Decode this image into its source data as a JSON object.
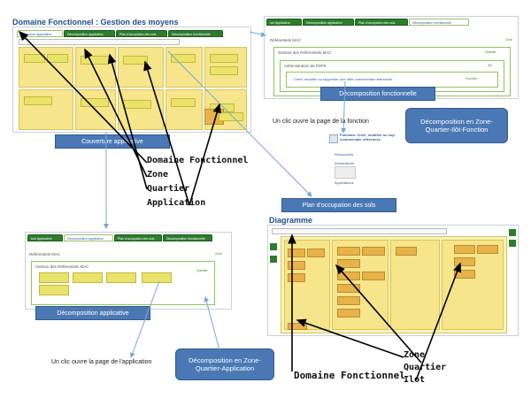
{
  "screens": {
    "main": {
      "title": "Domaine Fonctionnel : Gestion des moyens",
      "tabs": [
        "Couverture Applicative",
        "Décomposition applicative",
        "Plan d'occupation des sols",
        "Décomposition fonctionnelle"
      ]
    },
    "fonctionnelle": {
      "tabs": [
        "ure Applicative",
        "Décomposition applicative",
        "Plan d'occupation des sols",
        "Décomposition fonctionnelle"
      ],
      "heading": "Référentiels MAC",
      "zone_label": "Gestion des Référentiels MAC",
      "quartier_label": "Administration de l'OPS",
      "fonction_label": "Créer, modifier ou supprimer une offre commerciale référencée",
      "close_label": "Zone",
      "quartier_tag": "Quartier",
      "ilot_tag": "Ilot",
      "fonction_tag": "Fonction"
    },
    "fonction_detail": {
      "title": "Fonction: Créer, modifier ou sup commerciale référencée",
      "items": [
        "Ressources",
        "Informations",
        "Applications"
      ]
    },
    "applicative": {
      "tabs": [
        "ture Applicative",
        "Décomposition applicative",
        "Plan d'occupation des sols",
        "Décomposition fonctionnelle"
      ],
      "heading": "Référentiels MAC",
      "zone_label": "Gestion des Référentiels MAC",
      "close_label": "Zone",
      "quartier_tag": "Quartier"
    },
    "diagramme": {
      "title": "Diagramme"
    }
  },
  "labels": {
    "couverture": "Couverture applicative",
    "fonctionnelle": "Décomposition fonctionnelle",
    "plan": "Plan d'occupation des sols",
    "applicative": "Décomposition applicative",
    "box_zqif": "Décomposition en Zone-Quartier-Ilôt-Fonction",
    "box_zqa": "Décomposition en Zone-Quartier-Application",
    "click_fonction": "Un clic ouvre la page de la fonction",
    "click_application": "Un clic ouvre la page de l'application"
  },
  "annotations_left": {
    "domaine": "Domaine Fonctionnel",
    "zone": "Zone",
    "quartier": "Quartier",
    "application": "Application"
  },
  "annotations_right": {
    "zone": "Zone",
    "quartier": "Quartier",
    "ilot": "Ilot",
    "domaine": "Domaine Fonctionnel"
  },
  "colors": {
    "tab_green": "#2e7d2e",
    "label_blue": "#4a78b4",
    "zone_yellow": "#f6e58a",
    "note_yellow": "#e9e36a",
    "ilot_orange": "#e7b24a",
    "arrow_blue": "#7aa6d6"
  }
}
